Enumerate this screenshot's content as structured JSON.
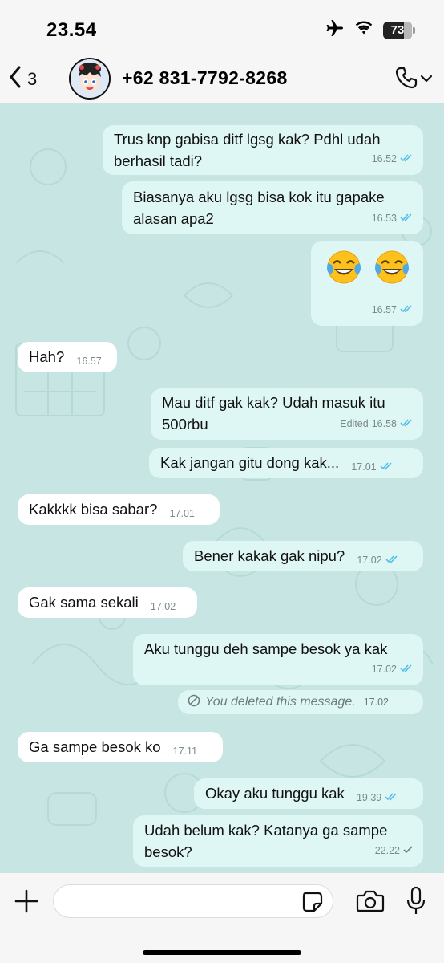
{
  "status_bar": {
    "time": "23.54",
    "battery": "73",
    "battery_level": 0.73,
    "icons": [
      "airplane-icon",
      "wifi-icon",
      "battery-icon"
    ]
  },
  "header": {
    "back_count": "3",
    "contact_name": "+62 831-7792-8268",
    "icons": [
      "chevron-left-icon",
      "phone-icon",
      "chevron-down-icon"
    ]
  },
  "messages": [
    {
      "dir": "out",
      "text": "Trus knp gabisa ditf lgsg kak? Pdhl udah\nberhasil tadi?",
      "time": "16.52",
      "ticks": "read"
    },
    {
      "dir": "out",
      "text": "Biasanya aku lgsg bisa kok itu gapake\nalasan apa2",
      "time": "16.53",
      "ticks": "read"
    },
    {
      "dir": "out",
      "emoji": "face-with-tears-of-joy x2",
      "time": "16.57",
      "ticks": "read"
    },
    {
      "dir": "in",
      "text": "Hah?",
      "time": "16.57"
    },
    {
      "dir": "out",
      "text": "Mau ditf gak kak? Udah masuk itu\n500rbu",
      "edited_label": "Edited",
      "time": "16.58",
      "ticks": "read"
    },
    {
      "dir": "out",
      "text": "Kak jangan gitu dong kak...",
      "time": "17.01",
      "ticks": "read"
    },
    {
      "dir": "in",
      "text": "Kakkkk bisa sabar?",
      "time": "17.01"
    },
    {
      "dir": "out",
      "text": "Bener kakak gak nipu?",
      "time": "17.02",
      "ticks": "read"
    },
    {
      "dir": "in",
      "text": "Gak sama sekali",
      "time": "17.02"
    },
    {
      "dir": "out",
      "text": "Aku tunggu deh sampe besok ya kak",
      "time": "17.02",
      "ticks": "read"
    },
    {
      "dir": "out",
      "deleted": "You deleted this message.",
      "time": "17.02"
    },
    {
      "dir": "in",
      "text": "Ga sampe besok ko",
      "time": "17.11"
    },
    {
      "dir": "out",
      "text": "Okay aku tunggu kak",
      "time": "19.39",
      "ticks": "read"
    },
    {
      "dir": "out",
      "text": "Udah belum kak? Katanya ga sampe\nbesok?",
      "time": "22.22",
      "ticks": "sent"
    }
  ],
  "input_bar": {
    "message_value": "",
    "icons": [
      "plus-icon",
      "sticker-icon",
      "camera-icon",
      "microphone-icon"
    ]
  },
  "colors": {
    "chat_background": "#c7e6e3",
    "outgoing_bubble": "#dff7f4",
    "incoming_bubble": "#ffffff",
    "read_ticks": "#53bdeb",
    "bar_background": "#f6f6f6"
  }
}
